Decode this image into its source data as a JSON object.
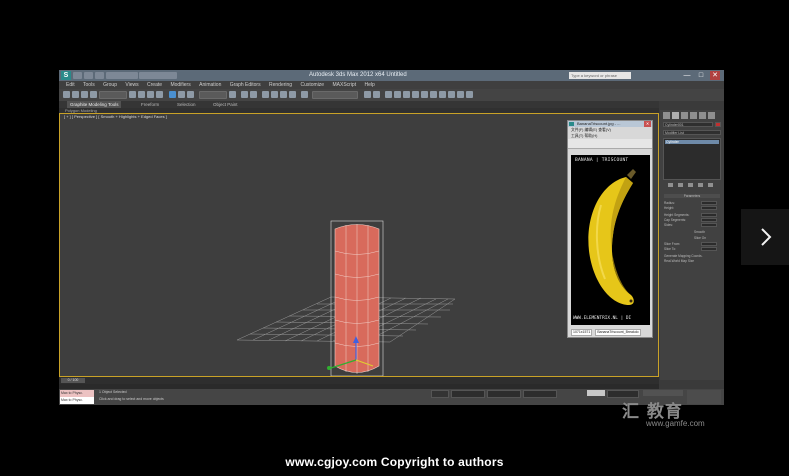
{
  "window": {
    "title": "Autodesk 3ds Max 2012 x64    Untitled",
    "search_placeholder": "Type a keyword or phrase",
    "minimize": "—",
    "maximize": "□",
    "close": "✕"
  },
  "menu": [
    "Edit",
    "Tools",
    "Group",
    "Views",
    "Create",
    "Modifiers",
    "Animation",
    "Graph Editors",
    "Rendering",
    "Customize",
    "MAXScript",
    "Help"
  ],
  "ribbon": {
    "tabs": [
      "Graphite Modeling Tools",
      "Freeform",
      "Selection",
      "Object Paint"
    ],
    "sub": "Polygon Modeling"
  },
  "viewport": {
    "label": "[ + ] [ Perspective ] [ Smooth + Highlights + Edged Faces ]",
    "colors": {
      "cylinder": "#d86a5c",
      "border": "#c9a227",
      "grid": "#9a9a9a"
    }
  },
  "command_panel": {
    "object_name": "Cylinder001",
    "modifier_list": "Modifier List",
    "stack_item": "Cylinder",
    "rollout_title": "Parameters",
    "params": [
      "Radius:",
      "Height:",
      "Height Segments:",
      "Cap Segments:",
      "Sides:",
      "Smooth",
      "Slice On",
      "Slice From:",
      "Slice To:",
      "Generate Mapping Coords.",
      "Real-World Map Size"
    ]
  },
  "image_viewer": {
    "title": "BananaTriscount.jpg - ...",
    "menu1": "文件(F)   编辑(E)   查看(V)",
    "menu2": "工具(T)   帮助(H)",
    "heading": "BANANA | TRISCOUNT",
    "footer": "WWW.ELEMENTRIX.NL | DI",
    "status_left": "1071x1571",
    "status_right": "BananaTriscount_Breakdo"
  },
  "timeline": {
    "frame": "0 / 100"
  },
  "status_bar": {
    "maxscript_line1": "Max to Physc.",
    "maxscript_line2": "Max to Physc.",
    "msg1": "1 Object Selected",
    "msg2": "Click and drag to select and move objects"
  },
  "next_button": {
    "icon": "chevron-right-icon",
    "glyph": "›"
  },
  "watermark": {
    "logo": "汇 教育",
    "site": "www.gamfe.com"
  },
  "caption": "www.cgjoy.com Copyright to authors"
}
